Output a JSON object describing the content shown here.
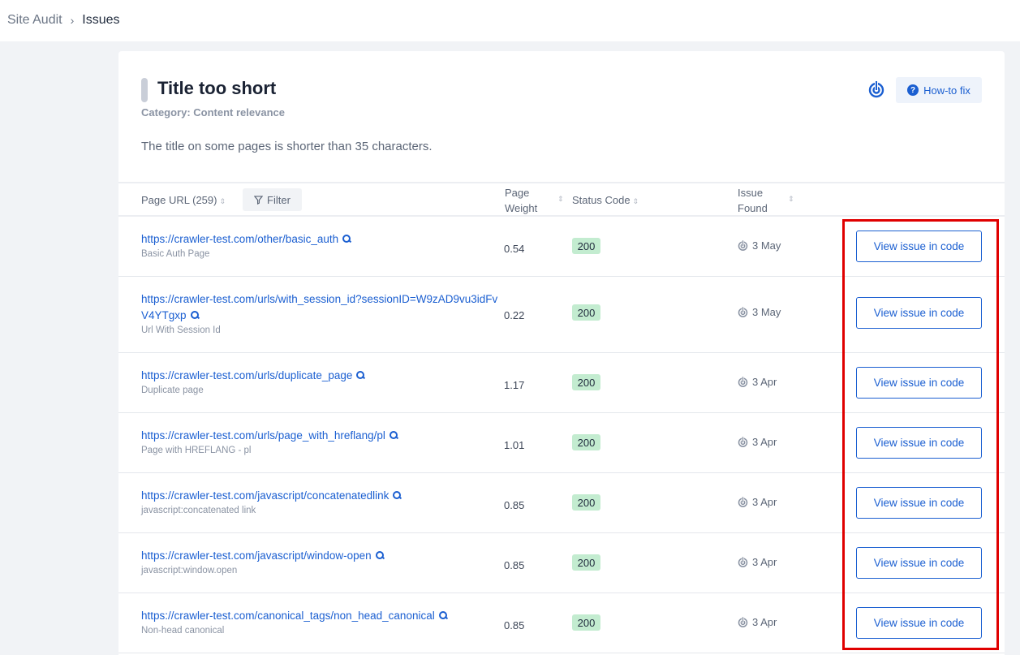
{
  "breadcrumb": {
    "parent": "Site Audit",
    "separator": "›",
    "current": "Issues"
  },
  "issue": {
    "title": "Title too short",
    "category": "Category: Content relevance",
    "description": "The title on some pages is shorter than 35 characters.",
    "howto_label": "How-to fix"
  },
  "table": {
    "headers": {
      "url": "Page URL (259)",
      "filter": "Filter",
      "weight": "Page Weight",
      "status": "Status Code",
      "found": "Issue Found"
    },
    "rows": [
      {
        "url": "https://crawler-test.com/other/basic_auth",
        "name": "Basic Auth Page",
        "weight": "0.54",
        "status": "200",
        "found": "3 May",
        "action": "View issue in code"
      },
      {
        "url": "https://crawler-test.com/urls/with_session_id?sessionID=W9zAD9vu3idFvV4YTgxp",
        "name": "Url With Session Id",
        "weight": "0.22",
        "status": "200",
        "found": "3 May",
        "action": "View issue in code"
      },
      {
        "url": "https://crawler-test.com/urls/duplicate_page",
        "name": "Duplicate page",
        "weight": "1.17",
        "status": "200",
        "found": "3 Apr",
        "action": "View issue in code"
      },
      {
        "url": "https://crawler-test.com/urls/page_with_hreflang/pl",
        "name": "Page with HREFLANG - pl",
        "weight": "1.01",
        "status": "200",
        "found": "3 Apr",
        "action": "View issue in code"
      },
      {
        "url": "https://crawler-test.com/javascript/concatenatedlink",
        "name": "javascript:concatenated link",
        "weight": "0.85",
        "status": "200",
        "found": "3 Apr",
        "action": "View issue in code"
      },
      {
        "url": "https://crawler-test.com/javascript/window-open",
        "name": "javascript:window.open",
        "weight": "0.85",
        "status": "200",
        "found": "3 Apr",
        "action": "View issue in code"
      },
      {
        "url": "https://crawler-test.com/canonical_tags/non_head_canonical",
        "name": "Non-head canonical",
        "weight": "0.85",
        "status": "200",
        "found": "3 Apr",
        "action": "View issue in code"
      }
    ]
  },
  "colors": {
    "accent": "#1b5fd1",
    "status_ok_bg": "#c3ecd0",
    "highlight": "#e00000"
  },
  "icons": {
    "priority": "radar-icon",
    "help": "question-circle-icon",
    "search": "magnifier-icon",
    "sort": "sort-arrows-icon",
    "filter": "funnel-icon"
  }
}
